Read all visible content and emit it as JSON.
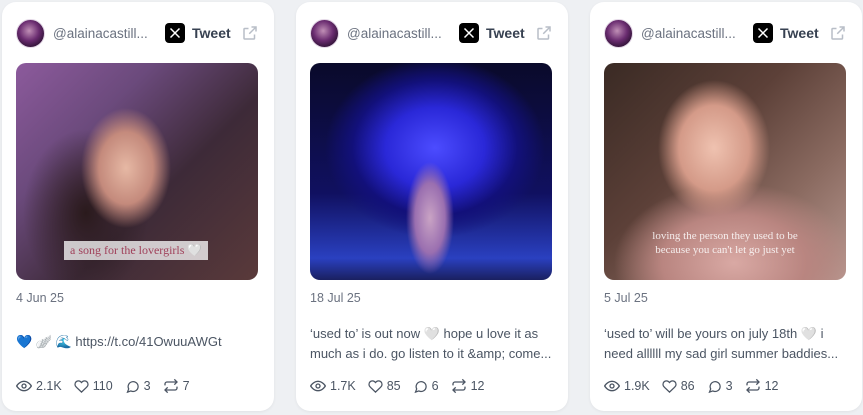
{
  "cards": [
    {
      "handle": "@alainacastill...",
      "tweet_label": "Tweet",
      "caption": "a song for the lovergirls 🤍",
      "date": "4 Jun 25",
      "text_lines": [
        "💙 🪽 🌊 https://t.co/41OwuuAWGt"
      ],
      "views": "2.1K",
      "likes": "110",
      "replies": "3",
      "retweets": "7"
    },
    {
      "handle": "@alainacastill...",
      "tweet_label": "Tweet",
      "caption": "",
      "date": "18 Jul 25",
      "text_lines": [
        "‘used to’ is out now 🤍 hope u love it as",
        "much as i do. go listen to it &amp; come..."
      ],
      "views": "1.7K",
      "likes": "85",
      "replies": "6",
      "retweets": "12"
    },
    {
      "handle": "@alainacastill...",
      "tweet_label": "Tweet",
      "caption": "loving the person they used to be because you can't let go just yet",
      "date": "5 Jul 25",
      "text_lines": [
        "‘used to’ will be yours on july 18th 🤍 i",
        "need allllll my sad girl summer baddies..."
      ],
      "views": "1.9K",
      "likes": "86",
      "replies": "3",
      "retweets": "12"
    }
  ],
  "icons": {
    "platform": "x-logo-icon",
    "external": "external-link-icon",
    "views": "eye-icon",
    "likes": "heart-icon",
    "replies": "comment-icon",
    "retweets": "retweet-icon"
  }
}
